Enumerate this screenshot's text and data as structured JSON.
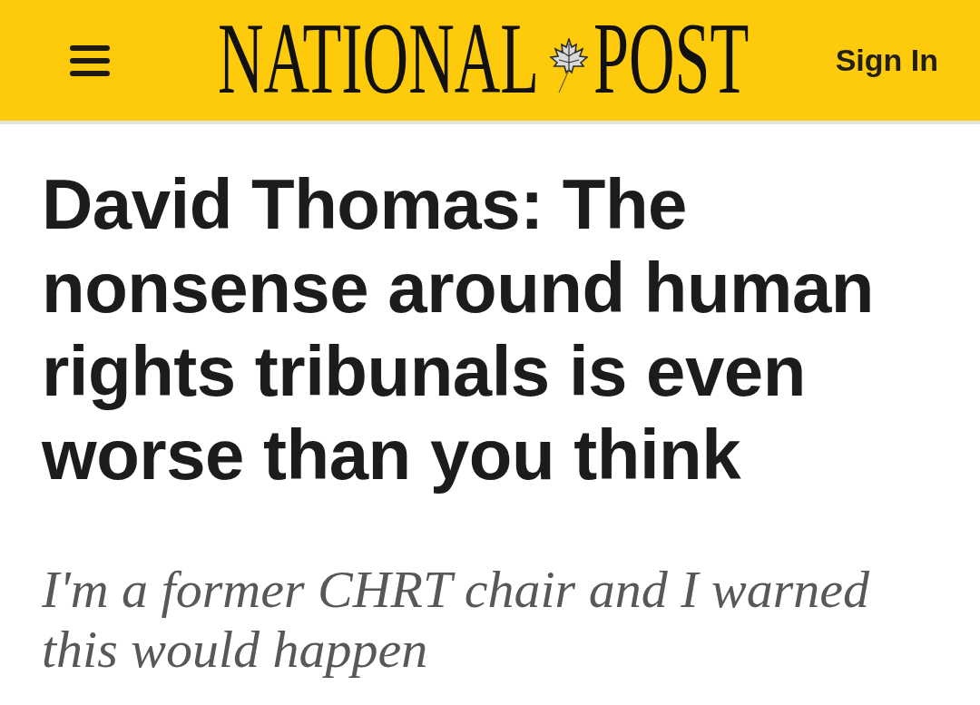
{
  "header": {
    "logo": [
      "NATIONAL",
      "POST"
    ],
    "sign_in": "Sign In"
  },
  "article": {
    "headline": "David Thomas: The nonsense around human rights tribunals is even worse than you think",
    "subheadline": "I'm a former CHRT chair and I warned this would happen"
  }
}
